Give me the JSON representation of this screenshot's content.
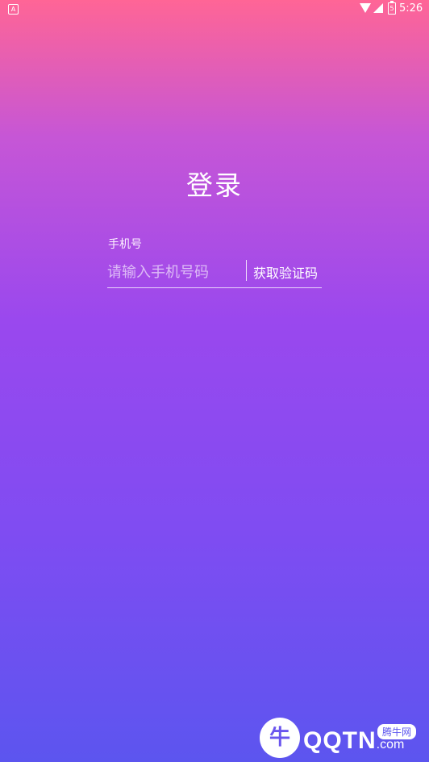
{
  "status_bar": {
    "notification": "A",
    "battery": "5",
    "time": "5:26"
  },
  "title": "登录",
  "form": {
    "phone_label": "手机号",
    "phone_placeholder": "请输入手机号码",
    "get_code_label": "获取验证码"
  },
  "watermark": {
    "brand": "QQTN",
    "domain_suffix": ".com",
    "badge": "腾牛网",
    "logo_glyph": "牛"
  },
  "colors": {
    "gradient_top": "#ff6596",
    "gradient_mid": "#9a48ee",
    "gradient_bottom": "#5c55ef"
  }
}
